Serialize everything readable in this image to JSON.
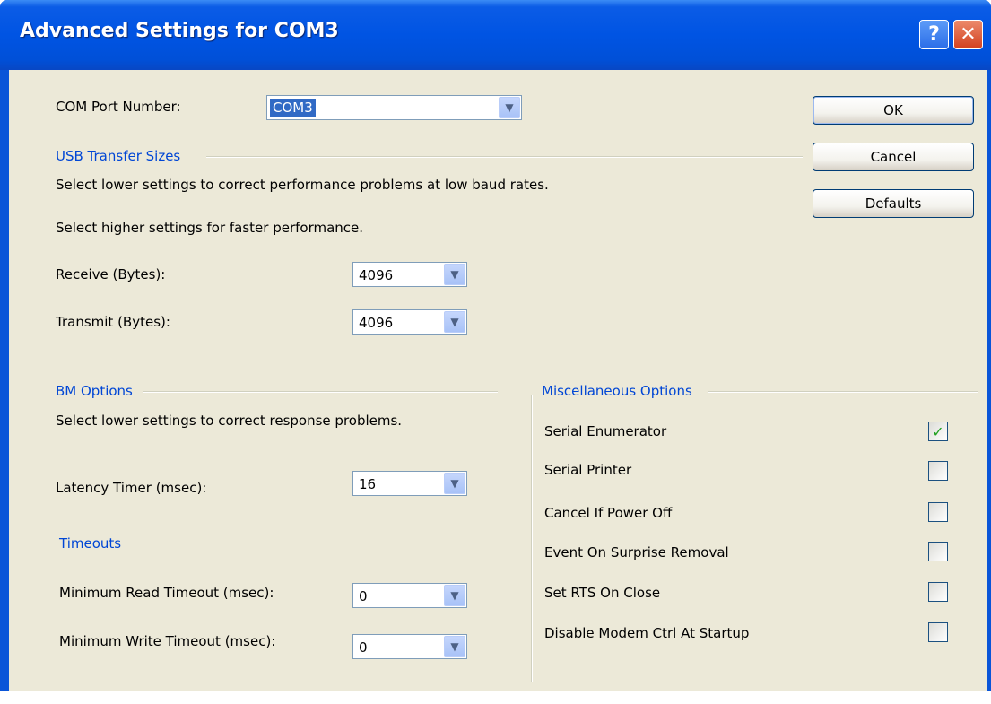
{
  "window": {
    "title": "Advanced Settings for COM3",
    "help_glyph": "?",
    "close_glyph": "✕"
  },
  "com_port": {
    "label": "COM Port Number:",
    "value": "COM3"
  },
  "usb_transfer": {
    "title": "USB Transfer Sizes",
    "hint_lower": "Select lower settings to correct performance problems at low baud rates.",
    "hint_higher": "Select higher settings for faster performance.",
    "receive_label": "Receive (Bytes):",
    "receive_value": "4096",
    "transmit_label": "Transmit (Bytes):",
    "transmit_value": "4096"
  },
  "bm_options": {
    "title": "BM Options",
    "hint": "Select lower settings to correct response problems.",
    "latency_label": "Latency Timer (msec):",
    "latency_value": "16"
  },
  "timeouts": {
    "title": "Timeouts",
    "read_label": "Minimum Read Timeout (msec):",
    "read_value": "0",
    "write_label": "Minimum Write Timeout (msec):",
    "write_value": "0"
  },
  "misc": {
    "title": "Miscellaneous Options",
    "items": [
      {
        "label": "Serial Enumerator",
        "checked": true
      },
      {
        "label": "Serial Printer",
        "checked": false
      },
      {
        "label": "Cancel If Power Off",
        "checked": false
      },
      {
        "label": "Event On Surprise Removal",
        "checked": false
      },
      {
        "label": "Set RTS On Close",
        "checked": false
      },
      {
        "label": "Disable Modem Ctrl At Startup",
        "checked": false
      }
    ]
  },
  "buttons": {
    "ok": "OK",
    "cancel": "Cancel",
    "defaults": "Defaults"
  },
  "icons": {
    "dropdown": "chevron-down-icon",
    "check": "checkmark-icon"
  },
  "colors": {
    "titlebar": "#0054e3",
    "group_title": "#0046d5",
    "dialog_bg": "#ece9d8",
    "selection": "#316ac5"
  }
}
